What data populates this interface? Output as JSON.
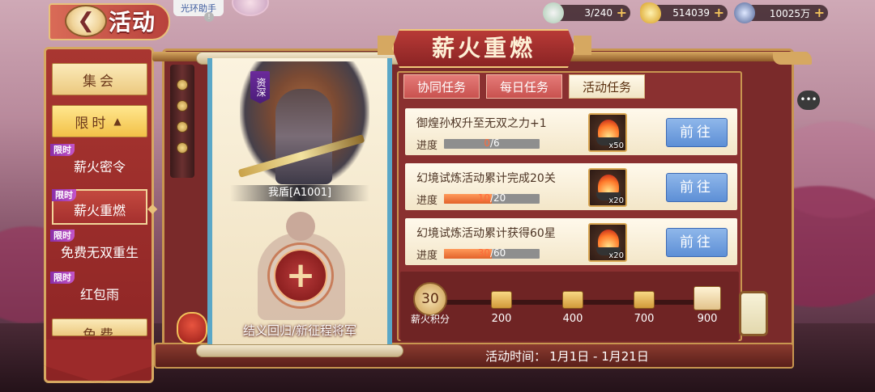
{
  "topbar": {
    "title": "活动",
    "back_icon": "back-arrow-icon",
    "helper_label": "光环助手"
  },
  "resources": [
    {
      "name": "stamina",
      "value": "3/240",
      "icon": "stamina-icon"
    },
    {
      "name": "gold",
      "value": "514039",
      "icon": "gold-ingot-icon"
    },
    {
      "name": "silver",
      "value": "10025万",
      "icon": "silver-coin-icon"
    }
  ],
  "menu": {
    "group1": "集会",
    "group2": "限时",
    "items": [
      {
        "tag": "限时",
        "label": "薪火密令"
      },
      {
        "tag": "限时",
        "label": "薪火重燃"
      },
      {
        "tag": "限时",
        "label": "免费无双重生"
      },
      {
        "tag": "限时",
        "label": "红包雨"
      }
    ],
    "group3_partial": "免费"
  },
  "event": {
    "title": "薪火重燃",
    "hero": {
      "quality": "资深",
      "name": "我盾[A1001]"
    },
    "recruit_label": "结义回归/新征程将军",
    "tabs": [
      "协同任务",
      "每日任务",
      "活动任务"
    ],
    "active_tab": 2,
    "tasks": [
      {
        "title": "御煌孙权升至无双之力+1",
        "progress_label": "进度",
        "current": "0",
        "total": "/6",
        "fraction": 0.0,
        "reward_count": "x50",
        "button": "前往"
      },
      {
        "title": "幻境试炼活动累计完成20关",
        "progress_label": "进度",
        "current": "10",
        "total": "/20",
        "fraction": 0.5,
        "reward_count": "x20",
        "button": "前往"
      },
      {
        "title": "幻境试炼活动累计获得60星",
        "progress_label": "进度",
        "current": "30",
        "total": "/60",
        "fraction": 0.5,
        "reward_count": "x20",
        "button": "前往"
      }
    ],
    "score": {
      "value": "30",
      "label": "薪火积分",
      "milestones": [
        "200",
        "400",
        "700",
        "900"
      ]
    },
    "time": {
      "label": "活动时间：",
      "range": "1月1日 - 1月21日"
    }
  }
}
